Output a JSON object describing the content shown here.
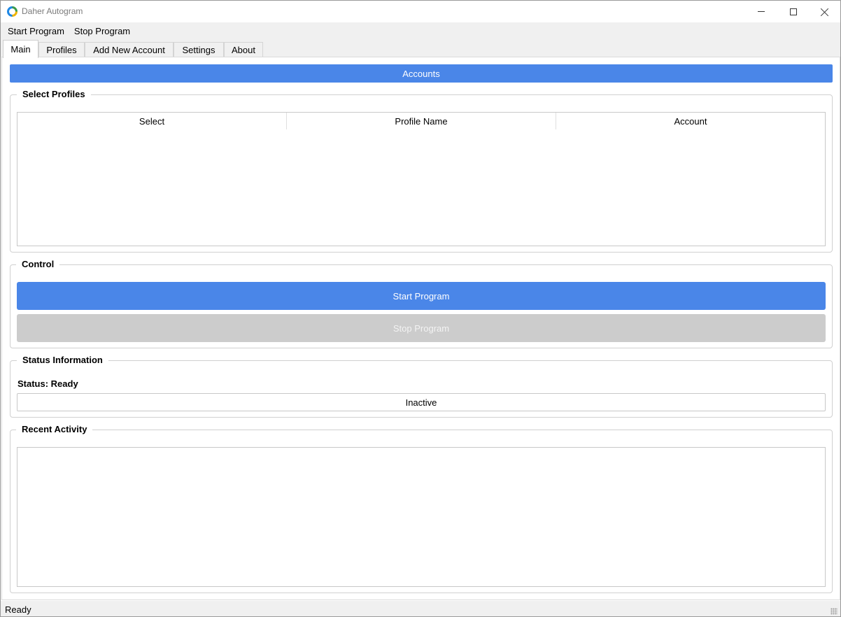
{
  "window": {
    "title": "Daher Autogram"
  },
  "menu": {
    "items": [
      "Start Program",
      "Stop Program"
    ]
  },
  "tabs": [
    {
      "label": "Main",
      "active": true
    },
    {
      "label": "Profiles",
      "active": false
    },
    {
      "label": "Add New Account",
      "active": false
    },
    {
      "label": "Settings",
      "active": false
    },
    {
      "label": "About",
      "active": false
    }
  ],
  "accounts_header": "Accounts",
  "select_profiles": {
    "title": "Select Profiles",
    "columns": [
      "Select",
      "Profile Name",
      "Account"
    ],
    "rows": []
  },
  "control": {
    "title": "Control",
    "start_label": "Start Program",
    "stop_label": "Stop Program"
  },
  "status_info": {
    "title": "Status Information",
    "status_text": "Status: Ready",
    "state_text": "Inactive"
  },
  "recent_activity": {
    "title": "Recent Activity",
    "entries": []
  },
  "statusbar": {
    "text": "Ready"
  },
  "colors": {
    "accent": "#4a86e8",
    "disabled": "#cccccc"
  }
}
